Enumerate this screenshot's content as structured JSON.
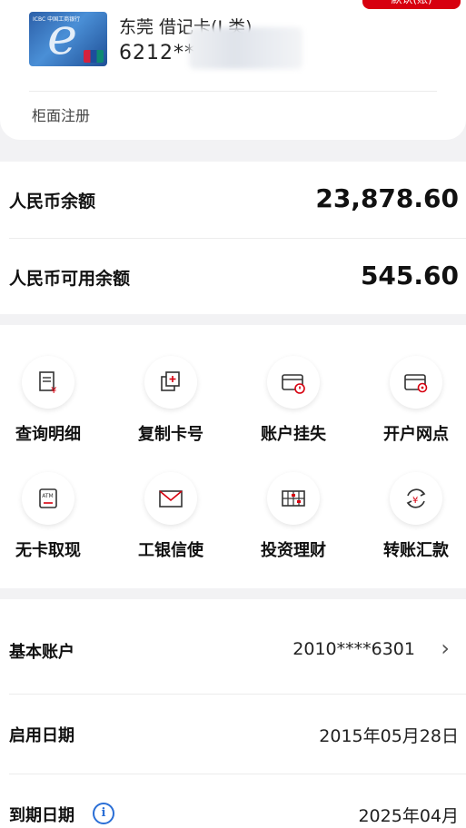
{
  "card": {
    "title": "东莞 借记卡(I 类)",
    "number_prefix": "6212**",
    "badge": "默认(账)",
    "counter_registration": "柜面注册"
  },
  "balances": {
    "rmb_balance_label": "人民币余额",
    "rmb_balance_value": "23,878.60",
    "rmb_available_label": "人民币可用余额",
    "rmb_available_value": "545.60"
  },
  "actions": [
    {
      "label": "查询明细",
      "icon": "statement-icon"
    },
    {
      "label": "复制卡号",
      "icon": "copy-icon"
    },
    {
      "label": "账户挂失",
      "icon": "card-lost-icon"
    },
    {
      "label": "开户网点",
      "icon": "card-location-icon"
    },
    {
      "label": "无卡取现",
      "icon": "atm-icon"
    },
    {
      "label": "工银信使",
      "icon": "envelope-icon"
    },
    {
      "label": "投资理财",
      "icon": "abacus-icon"
    },
    {
      "label": "转账汇款",
      "icon": "transfer-icon"
    }
  ],
  "info": {
    "basic_account_label": "基本账户",
    "basic_account_value": "2010****6301",
    "start_date_label": "启用日期",
    "start_date_value": "2015年05月28日",
    "expiry_label": "到期日期",
    "expiry_value": "2025年04月"
  },
  "colors": {
    "accent": "#d7000f",
    "info_blue": "#2b6fd6"
  }
}
